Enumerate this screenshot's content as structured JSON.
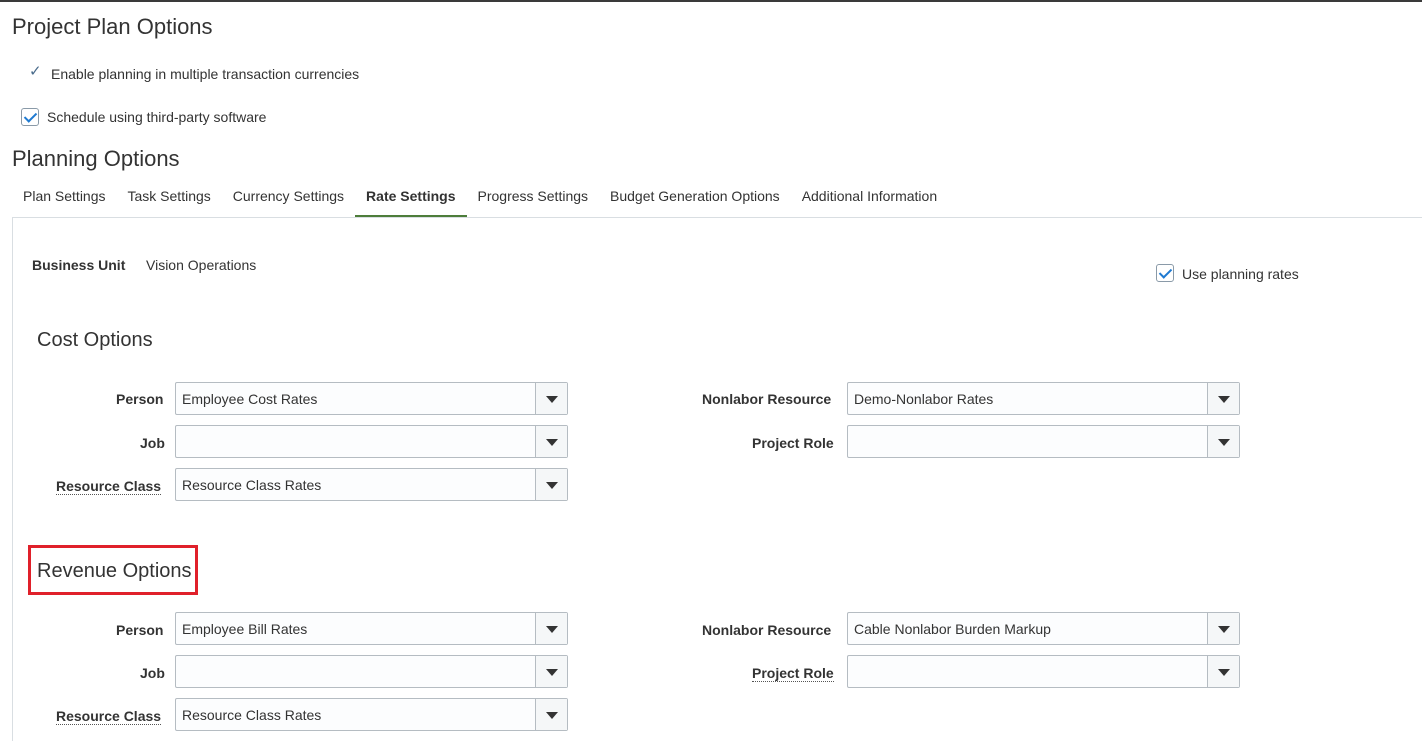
{
  "page": {
    "title": "Project Plan Options",
    "readonly_option": "Enable planning in multiple transaction currencies",
    "schedule_option": "Schedule using third-party software",
    "section_title": "Planning Options"
  },
  "tabs": [
    {
      "label": "Plan Settings"
    },
    {
      "label": "Task Settings"
    },
    {
      "label": "Currency Settings"
    },
    {
      "label": "Rate Settings",
      "active": true
    },
    {
      "label": "Progress Settings"
    },
    {
      "label": "Budget Generation Options"
    },
    {
      "label": "Additional Information"
    }
  ],
  "rate_settings": {
    "business_unit_label": "Business Unit",
    "business_unit_value": "Vision Operations",
    "use_planning_rates": "Use planning rates",
    "cost": {
      "title": "Cost Options",
      "person_label": "Person",
      "person_value": "Employee Cost Rates",
      "job_label": "Job",
      "job_value": "",
      "resource_class_label": "Resource Class",
      "resource_class_value": "Resource Class Rates",
      "nonlabor_label": "Nonlabor Resource",
      "nonlabor_value": "Demo-Nonlabor Rates",
      "project_role_label": "Project Role",
      "project_role_value": ""
    },
    "revenue": {
      "title": "Revenue Options",
      "person_label": "Person",
      "person_value": "Employee Bill Rates",
      "job_label": "Job",
      "job_value": "",
      "resource_class_label": "Resource Class",
      "resource_class_value": "Resource Class Rates",
      "nonlabor_label": "Nonlabor Resource",
      "nonlabor_value": "Cable Nonlabor Burden Markup",
      "project_role_label": "Project Role",
      "project_role_value": ""
    }
  },
  "colors": {
    "active_tab_underline": "#4d7d3a",
    "checkbox_check": "#1f7ad1",
    "highlight_box": "#e0202a"
  },
  "icons": {
    "readonly_check": "checkmark-icon",
    "dropdown": "chevron-down-icon"
  }
}
